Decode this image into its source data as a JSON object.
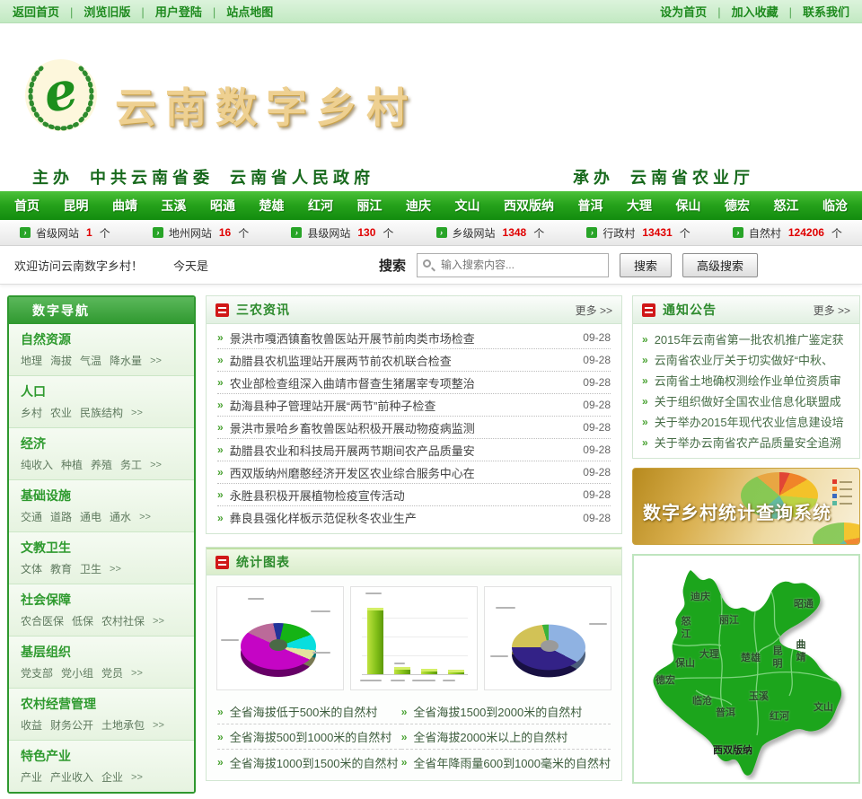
{
  "topbar": {
    "separator": "|",
    "left": [
      "返回首页",
      "浏览旧版",
      "用户登陆",
      "站点地图"
    ],
    "right": [
      "设为首页",
      "加入收藏",
      "联系我们"
    ]
  },
  "header": {
    "site_title": "云南数字乡村",
    "host_label": "主办",
    "host_1": "中共云南省委",
    "host_2": "云南省人民政府",
    "organizer_label": "承办",
    "organizer": "云南省农业厅"
  },
  "nav": {
    "items": [
      "首页",
      "昆明",
      "曲靖",
      "玉溪",
      "昭通",
      "楚雄",
      "红河",
      "丽江",
      "迪庆",
      "文山",
      "西双版纳",
      "普洱",
      "大理",
      "保山",
      "德宏",
      "怒江",
      "临沧"
    ]
  },
  "stats": {
    "items": [
      {
        "label": "省级网站",
        "value": "1",
        "unit": "个"
      },
      {
        "label": "地州网站",
        "value": "16",
        "unit": "个"
      },
      {
        "label": "县级网站",
        "value": "130",
        "unit": "个"
      },
      {
        "label": "乡级网站",
        "value": "1348",
        "unit": "个"
      },
      {
        "label": "行政村",
        "value": "13431",
        "unit": "个"
      },
      {
        "label": "自然村",
        "value": "124206",
        "unit": "个"
      }
    ]
  },
  "welcome": {
    "greeting": "欢迎访问云南数字乡村！",
    "today": "今天是",
    "search_label": "搜索",
    "search_placeholder": "输入搜索内容...",
    "search_button": "搜索",
    "advanced_search_button": "高级搜索"
  },
  "sidebar": {
    "title": "数字导航",
    "more": ">>",
    "sections": [
      {
        "title": "自然资源",
        "links": [
          "地理",
          "海拔",
          "气温",
          "降水量"
        ]
      },
      {
        "title": "人口",
        "links": [
          "乡村",
          "农业",
          "民族结构"
        ]
      },
      {
        "title": "经济",
        "links": [
          "纯收入",
          "种植",
          "养殖",
          "务工"
        ]
      },
      {
        "title": "基础设施",
        "links": [
          "交通",
          "道路",
          "通电",
          "通水"
        ]
      },
      {
        "title": "文教卫生",
        "links": [
          "文体",
          "教育",
          "卫生"
        ]
      },
      {
        "title": "社会保障",
        "links": [
          "农合医保",
          "低保",
          "农村社保"
        ]
      },
      {
        "title": "基层组织",
        "links": [
          "党支部",
          "党小组",
          "党员"
        ]
      },
      {
        "title": "农村经营管理",
        "links": [
          "收益",
          "财务公开",
          "土地承包"
        ]
      },
      {
        "title": "特色产业",
        "links": [
          "产业",
          "产业收入",
          "企业"
        ]
      }
    ]
  },
  "news": {
    "title": "三农资讯",
    "more": "更多 >>",
    "bullet": "»",
    "items": [
      {
        "text": "景洪市嘎洒镇畜牧兽医站开展节前肉类市场检查",
        "date": "09-28"
      },
      {
        "text": "勐腊县农机监理站开展两节前农机联合检查",
        "date": "09-28"
      },
      {
        "text": "农业部检查组深入曲靖市督查生猪屠宰专项整治",
        "date": "09-28"
      },
      {
        "text": "勐海县种子管理站开展“两节”前种子检查",
        "date": "09-28"
      },
      {
        "text": "景洪市景哈乡畜牧兽医站积极开展动物疫病监测",
        "date": "09-28"
      },
      {
        "text": "勐腊县农业和科技局开展两节期间农产品质量安",
        "date": "09-28"
      },
      {
        "text": "西双版纳州磨憨经济开发区农业综合服务中心在",
        "date": "09-28"
      },
      {
        "text": "永胜县积极开展植物检疫宣传活动",
        "date": "09-28"
      },
      {
        "text": "彝良县强化样板示范促秋冬农业生产",
        "date": "09-28"
      }
    ]
  },
  "notices": {
    "title": "通知公告",
    "more": "更多 >>",
    "items": [
      "2015年云南省第一批农机推广鉴定获",
      "云南省农业厅关于切实做好“中秋、",
      "云南省土地确权测绘作业单位资质审",
      "关于组织做好全国农业信息化联盟成",
      "关于举办2015年现代农业信息建设培",
      "关于举办云南省农产品质量安全追溯"
    ]
  },
  "banner": {
    "title": "数字乡村统计查询系统"
  },
  "charts": {
    "title": "统计图表",
    "thumbnails": [
      {
        "type": "pie",
        "palette": [
          "#15b315",
          "#09dede",
          "#e4e49e",
          "#c505c5",
          "#bb6a99",
          "#223399"
        ]
      },
      {
        "type": "bar",
        "palette": [
          "#84c11a"
        ],
        "relative_heights": [
          1,
          0.09,
          0.06,
          0.05
        ]
      },
      {
        "type": "pie",
        "palette": [
          "#8fb2e2",
          "#332287",
          "#d2c256",
          "#3ab33a"
        ]
      }
    ],
    "links": [
      "全省海拔低于500米的自然村",
      "全省海拔1500到2000米的自然村",
      "全省海拔500到1000米的自然村",
      "全省海拔2000米以上的自然村",
      "全省海拔1000到1500米的自然村",
      "全省年降雨量600到1000毫米的自然村"
    ]
  },
  "map": {
    "regions": [
      "迪庆",
      "昭通",
      "丽江",
      "怒江",
      "大理",
      "楚雄",
      "昆明",
      "曲靖",
      "保山",
      "德宏",
      "临沧",
      "玉溪",
      "普洱",
      "红河",
      "文山",
      "西双版纳"
    ]
  },
  "colors": {
    "accent_green": "#27a31c",
    "light_green_bar": "#cdeccd",
    "gold_title": "#eed091",
    "stat_number_red": "#e00000",
    "banner_gold": "#d9af4e"
  }
}
